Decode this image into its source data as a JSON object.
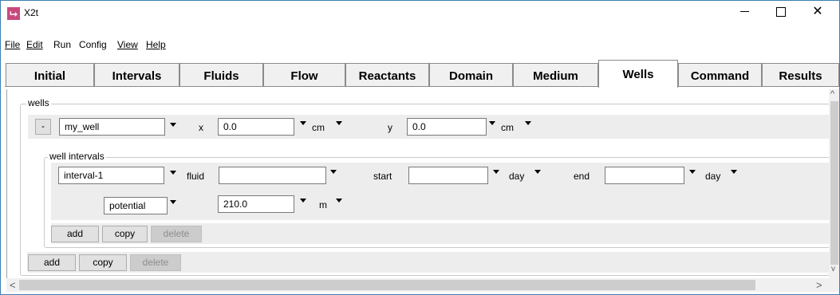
{
  "window": {
    "title": "X2t",
    "icon": "app-logo-icon",
    "controls": {
      "minimize": "—",
      "maximize": "☐",
      "close": "✕"
    }
  },
  "menu": [
    {
      "label": "File",
      "mnemonic": "F"
    },
    {
      "label": "Edit",
      "mnemonic": "E"
    },
    {
      "label": "Run",
      "mnemonic": ""
    },
    {
      "label": "Config",
      "mnemonic": ""
    },
    {
      "label": "View",
      "mnemonic": "V"
    },
    {
      "label": "Help",
      "mnemonic": "H"
    }
  ],
  "tabs": [
    "Initial",
    "Intervals",
    "Fluids",
    "Flow",
    "Reactants",
    "Domain",
    "Medium",
    "Wells",
    "Command",
    "Results"
  ],
  "active_tab": "Wells",
  "wells": {
    "legend": "wells",
    "collapse_label": "-",
    "well_name": "my_well",
    "x_label": "x",
    "x_value": "0.0",
    "x_unit": "cm",
    "y_label": "y",
    "y_value": "0.0",
    "y_unit": "cm",
    "intervals": {
      "legend": "well intervals",
      "interval_name": "interval-1",
      "fluid_label": "fluid",
      "fluid_value": "",
      "start_label": "start",
      "start_value": "",
      "start_unit": "day",
      "end_label": "end",
      "end_value": "",
      "end_unit": "day",
      "quantity": "potential",
      "quantity_value": "210.0",
      "quantity_unit": "m",
      "buttons": {
        "add": "add",
        "copy": "copy",
        "delete": "delete"
      }
    },
    "buttons": {
      "add": "add",
      "copy": "copy",
      "delete": "delete"
    }
  },
  "scrollbars": {
    "up": "^",
    "down": "v",
    "left": "<",
    "right": ">"
  }
}
